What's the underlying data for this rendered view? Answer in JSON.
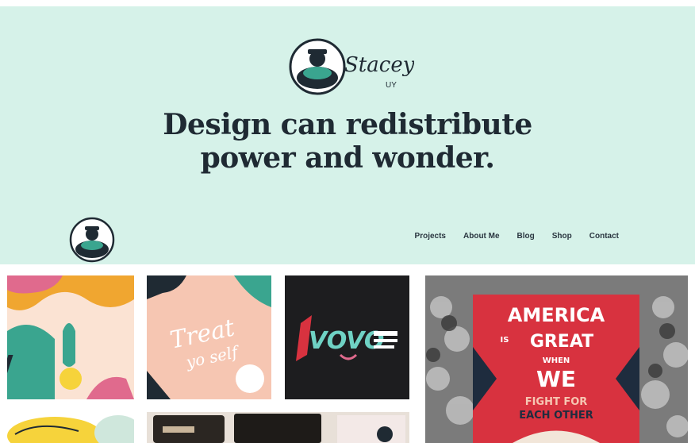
{
  "brand": {
    "logo_script": "Stacey",
    "logo_sub": "UY"
  },
  "hero": {
    "headline_line1": "Design can redistribute",
    "headline_line2": "power and wonder."
  },
  "nav": {
    "items": [
      {
        "label": "Projects"
      },
      {
        "label": "About Me"
      },
      {
        "label": "Blog"
      },
      {
        "label": "Shop"
      },
      {
        "label": "Contact"
      }
    ]
  },
  "gallery": {
    "tile2_text_line1": "Treat",
    "tile2_text_line2": "yo self",
    "tile3_text": "VOVO",
    "poster": {
      "line1": "AMERICA",
      "line2_small": "IS",
      "line2": "GREAT",
      "line3_small": "WHEN",
      "line4": "WE",
      "line5": "FIGHT FOR",
      "line6": "EACH OTHER"
    }
  },
  "colors": {
    "hero_bg": "#d6f2e9",
    "ink": "#1f2a33",
    "teal": "#3aa58f",
    "poster_red": "#d8323f",
    "poster_navy": "#1e2c3e",
    "peach": "#f6c6b2"
  }
}
